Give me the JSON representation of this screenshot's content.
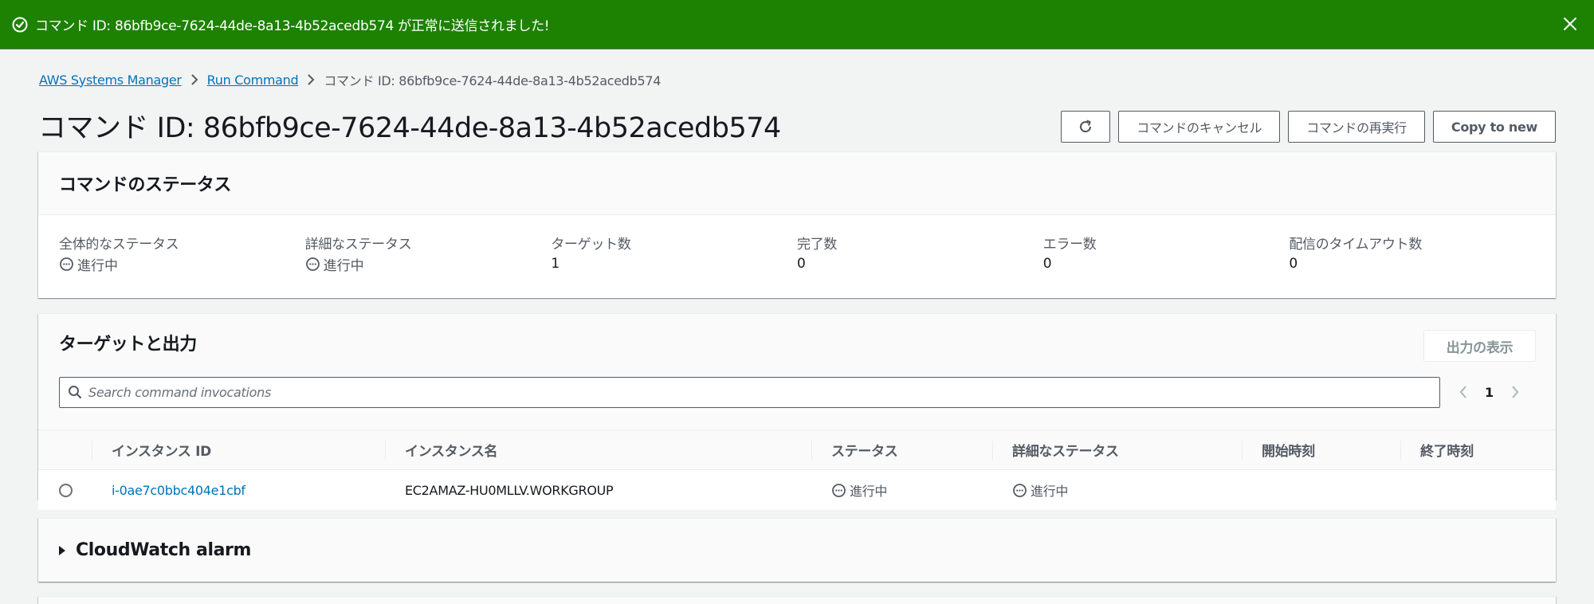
{
  "flash": {
    "message": "コマンド ID: 86bfb9ce-7624-44de-8a13-4b52acedb574 が正常に送信されました!",
    "type": "success",
    "color": "#1d8102",
    "icon": "check-circle-icon",
    "close_icon": "close-icon"
  },
  "breadcrumb": {
    "items": [
      {
        "label": "AWS Systems Manager",
        "link": true
      },
      {
        "label": "Run Command",
        "link": true
      },
      {
        "label": "コマンド ID: 86bfb9ce-7624-44de-8a13-4b52acedb574",
        "link": false
      }
    ]
  },
  "header": {
    "title": "コマンド ID: 86bfb9ce-7624-44de-8a13-4b52acedb574",
    "buttons": {
      "refresh_icon": "refresh-icon",
      "cancel": "コマンドのキャンセル",
      "rerun": "コマンドの再実行",
      "copy": "Copy to new"
    }
  },
  "command_status": {
    "title": "コマンドのステータス",
    "fields": [
      {
        "label": "全体的なステータス",
        "value": "進行中",
        "icon": "in-progress-icon"
      },
      {
        "label": "詳細なステータス",
        "value": "進行中",
        "icon": "in-progress-icon"
      },
      {
        "label": "ターゲット数",
        "value": "1"
      },
      {
        "label": "完了数",
        "value": "0"
      },
      {
        "label": "エラー数",
        "value": "0"
      },
      {
        "label": "配信のタイムアウト数",
        "value": "0"
      }
    ]
  },
  "targets": {
    "title": "ターゲットと出力",
    "view_output_button": "出力の表示",
    "search_placeholder": "Search command invocations",
    "search_value": "",
    "pagination": {
      "current_page": "1"
    },
    "columns": [
      "インスタンス ID",
      "インスタンス名",
      "ステータス",
      "詳細なステータス",
      "開始時刻",
      "終了時刻"
    ],
    "rows": [
      {
        "instance_id": "i-0ae7c0bbc404e1cbf",
        "instance_name": "EC2AMAZ-HU0MLLV.WORKGROUP",
        "status": "進行中",
        "detailed_status": "進行中",
        "start_time": "",
        "end_time": ""
      }
    ]
  },
  "cloudwatch": {
    "title": "CloudWatch alarm",
    "expanded": false
  },
  "colors": {
    "link": "#0073bb",
    "success": "#1d8102",
    "background": "#f2f3f3"
  }
}
